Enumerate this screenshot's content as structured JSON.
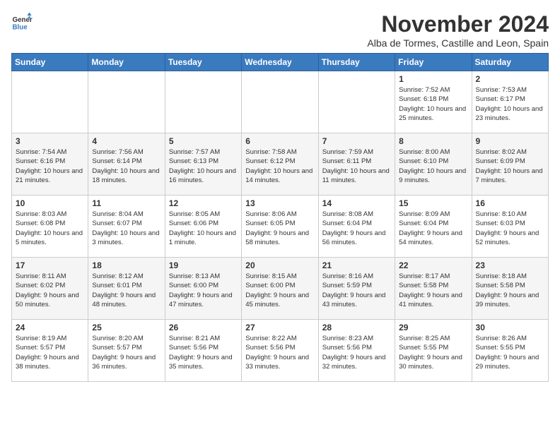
{
  "logo": {
    "general": "General",
    "blue": "Blue"
  },
  "title": "November 2024",
  "subtitle": "Alba de Tormes, Castille and Leon, Spain",
  "days_header": [
    "Sunday",
    "Monday",
    "Tuesday",
    "Wednesday",
    "Thursday",
    "Friday",
    "Saturday"
  ],
  "weeks": [
    [
      {
        "day": "",
        "info": ""
      },
      {
        "day": "",
        "info": ""
      },
      {
        "day": "",
        "info": ""
      },
      {
        "day": "",
        "info": ""
      },
      {
        "day": "",
        "info": ""
      },
      {
        "day": "1",
        "info": "Sunrise: 7:52 AM\nSunset: 6:18 PM\nDaylight: 10 hours and 25 minutes."
      },
      {
        "day": "2",
        "info": "Sunrise: 7:53 AM\nSunset: 6:17 PM\nDaylight: 10 hours and 23 minutes."
      }
    ],
    [
      {
        "day": "3",
        "info": "Sunrise: 7:54 AM\nSunset: 6:16 PM\nDaylight: 10 hours and 21 minutes."
      },
      {
        "day": "4",
        "info": "Sunrise: 7:56 AM\nSunset: 6:14 PM\nDaylight: 10 hours and 18 minutes."
      },
      {
        "day": "5",
        "info": "Sunrise: 7:57 AM\nSunset: 6:13 PM\nDaylight: 10 hours and 16 minutes."
      },
      {
        "day": "6",
        "info": "Sunrise: 7:58 AM\nSunset: 6:12 PM\nDaylight: 10 hours and 14 minutes."
      },
      {
        "day": "7",
        "info": "Sunrise: 7:59 AM\nSunset: 6:11 PM\nDaylight: 10 hours and 11 minutes."
      },
      {
        "day": "8",
        "info": "Sunrise: 8:00 AM\nSunset: 6:10 PM\nDaylight: 10 hours and 9 minutes."
      },
      {
        "day": "9",
        "info": "Sunrise: 8:02 AM\nSunset: 6:09 PM\nDaylight: 10 hours and 7 minutes."
      }
    ],
    [
      {
        "day": "10",
        "info": "Sunrise: 8:03 AM\nSunset: 6:08 PM\nDaylight: 10 hours and 5 minutes."
      },
      {
        "day": "11",
        "info": "Sunrise: 8:04 AM\nSunset: 6:07 PM\nDaylight: 10 hours and 3 minutes."
      },
      {
        "day": "12",
        "info": "Sunrise: 8:05 AM\nSunset: 6:06 PM\nDaylight: 10 hours and 1 minute."
      },
      {
        "day": "13",
        "info": "Sunrise: 8:06 AM\nSunset: 6:05 PM\nDaylight: 9 hours and 58 minutes."
      },
      {
        "day": "14",
        "info": "Sunrise: 8:08 AM\nSunset: 6:04 PM\nDaylight: 9 hours and 56 minutes."
      },
      {
        "day": "15",
        "info": "Sunrise: 8:09 AM\nSunset: 6:04 PM\nDaylight: 9 hours and 54 minutes."
      },
      {
        "day": "16",
        "info": "Sunrise: 8:10 AM\nSunset: 6:03 PM\nDaylight: 9 hours and 52 minutes."
      }
    ],
    [
      {
        "day": "17",
        "info": "Sunrise: 8:11 AM\nSunset: 6:02 PM\nDaylight: 9 hours and 50 minutes."
      },
      {
        "day": "18",
        "info": "Sunrise: 8:12 AM\nSunset: 6:01 PM\nDaylight: 9 hours and 48 minutes."
      },
      {
        "day": "19",
        "info": "Sunrise: 8:13 AM\nSunset: 6:00 PM\nDaylight: 9 hours and 47 minutes."
      },
      {
        "day": "20",
        "info": "Sunrise: 8:15 AM\nSunset: 6:00 PM\nDaylight: 9 hours and 45 minutes."
      },
      {
        "day": "21",
        "info": "Sunrise: 8:16 AM\nSunset: 5:59 PM\nDaylight: 9 hours and 43 minutes."
      },
      {
        "day": "22",
        "info": "Sunrise: 8:17 AM\nSunset: 5:58 PM\nDaylight: 9 hours and 41 minutes."
      },
      {
        "day": "23",
        "info": "Sunrise: 8:18 AM\nSunset: 5:58 PM\nDaylight: 9 hours and 39 minutes."
      }
    ],
    [
      {
        "day": "24",
        "info": "Sunrise: 8:19 AM\nSunset: 5:57 PM\nDaylight: 9 hours and 38 minutes."
      },
      {
        "day": "25",
        "info": "Sunrise: 8:20 AM\nSunset: 5:57 PM\nDaylight: 9 hours and 36 minutes."
      },
      {
        "day": "26",
        "info": "Sunrise: 8:21 AM\nSunset: 5:56 PM\nDaylight: 9 hours and 35 minutes."
      },
      {
        "day": "27",
        "info": "Sunrise: 8:22 AM\nSunset: 5:56 PM\nDaylight: 9 hours and 33 minutes."
      },
      {
        "day": "28",
        "info": "Sunrise: 8:23 AM\nSunset: 5:56 PM\nDaylight: 9 hours and 32 minutes."
      },
      {
        "day": "29",
        "info": "Sunrise: 8:25 AM\nSunset: 5:55 PM\nDaylight: 9 hours and 30 minutes."
      },
      {
        "day": "30",
        "info": "Sunrise: 8:26 AM\nSunset: 5:55 PM\nDaylight: 9 hours and 29 minutes."
      }
    ]
  ]
}
